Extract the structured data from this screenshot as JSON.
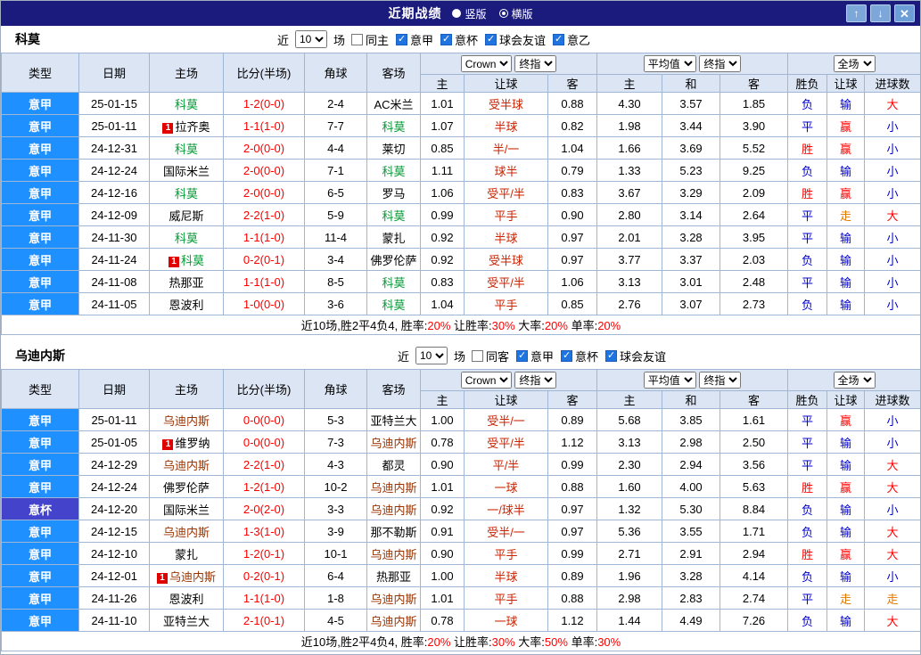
{
  "titlebar": {
    "title": "近期战绩",
    "layout_options": [
      {
        "label": "竖版",
        "selected": false
      },
      {
        "label": "横版",
        "selected": true
      }
    ],
    "up_button": "↑",
    "down_button": "↓",
    "close_button": "✕"
  },
  "labels": {
    "near": "近",
    "count": "10",
    "games": "场"
  },
  "headers": {
    "type": "类型",
    "date": "日期",
    "home": "主场",
    "score": "比分(半场)",
    "corner": "角球",
    "away": "客场",
    "sub": [
      "主",
      "让球",
      "客",
      "主",
      "和",
      "客",
      "胜负",
      "让球",
      "进球数"
    ],
    "selects": {
      "bookmaker": "Crown",
      "final_index_1": "终指",
      "average": "平均值",
      "final_index_2": "终指",
      "scope": "全场"
    }
  },
  "cup_label": "意杯",
  "card_badge": "1",
  "colors": {
    "accent_red": "#ff0000",
    "accent_blue": "#0000cc",
    "accent_orange": "#e07800",
    "handicap_red": "#cc2200",
    "league_bg": "#1e90ff",
    "cup_bg": "#4343cc",
    "titlebar_bg": "#1b1b7d"
  },
  "result_colors": {
    "胜": "accent_red",
    "赢": "accent_red",
    "大": "accent_red",
    "平": "accent_blue",
    "负": "accent_blue",
    "输": "accent_blue",
    "小": "accent_blue",
    "走": "accent_orange"
  },
  "tables": [
    {
      "team": "科莫",
      "team_color": "#009933",
      "filters": [
        {
          "label": "同主",
          "checked": false
        },
        {
          "label": "意甲",
          "checked": true
        },
        {
          "label": "意杯",
          "checked": true
        },
        {
          "label": "球会友谊",
          "checked": true
        },
        {
          "label": "意乙",
          "checked": true
        }
      ],
      "rows": [
        {
          "type": "意甲",
          "date": "25-01-15",
          "home": "科莫",
          "card": false,
          "score": "1-2(0-0)",
          "corner": "2-4",
          "away": "AC米兰",
          "odds": [
            "1.01",
            "受半球",
            "0.88"
          ],
          "avg": [
            "4.30",
            "3.57",
            "1.85"
          ],
          "res": [
            "负",
            "输",
            "大"
          ]
        },
        {
          "type": "意甲",
          "date": "25-01-11",
          "home": "拉齐奥",
          "card": true,
          "score": "1-1(1-0)",
          "corner": "7-7",
          "away": "科莫",
          "odds": [
            "1.07",
            "半球",
            "0.82"
          ],
          "avg": [
            "1.98",
            "3.44",
            "3.90"
          ],
          "res": [
            "平",
            "赢",
            "小"
          ]
        },
        {
          "type": "意甲",
          "date": "24-12-31",
          "home": "科莫",
          "card": false,
          "score": "2-0(0-0)",
          "corner": "4-4",
          "away": "莱切",
          "odds": [
            "0.85",
            "半/一",
            "1.04"
          ],
          "avg": [
            "1.66",
            "3.69",
            "5.52"
          ],
          "res": [
            "胜",
            "赢",
            "小"
          ]
        },
        {
          "type": "意甲",
          "date": "24-12-24",
          "home": "国际米兰",
          "card": false,
          "score": "2-0(0-0)",
          "corner": "7-1",
          "away": "科莫",
          "odds": [
            "1.11",
            "球半",
            "0.79"
          ],
          "avg": [
            "1.33",
            "5.23",
            "9.25"
          ],
          "res": [
            "负",
            "输",
            "小"
          ]
        },
        {
          "type": "意甲",
          "date": "24-12-16",
          "home": "科莫",
          "card": false,
          "score": "2-0(0-0)",
          "corner": "6-5",
          "away": "罗马",
          "odds": [
            "1.06",
            "受平/半",
            "0.83"
          ],
          "avg": [
            "3.67",
            "3.29",
            "2.09"
          ],
          "res": [
            "胜",
            "赢",
            "小"
          ]
        },
        {
          "type": "意甲",
          "date": "24-12-09",
          "home": "威尼斯",
          "card": false,
          "score": "2-2(1-0)",
          "corner": "5-9",
          "away": "科莫",
          "odds": [
            "0.99",
            "平手",
            "0.90"
          ],
          "avg": [
            "2.80",
            "3.14",
            "2.64"
          ],
          "res": [
            "平",
            "走",
            "大"
          ]
        },
        {
          "type": "意甲",
          "date": "24-11-30",
          "home": "科莫",
          "card": false,
          "score": "1-1(1-0)",
          "corner": "11-4",
          "away": "蒙扎",
          "odds": [
            "0.92",
            "半球",
            "0.97"
          ],
          "avg": [
            "2.01",
            "3.28",
            "3.95"
          ],
          "res": [
            "平",
            "输",
            "小"
          ]
        },
        {
          "type": "意甲",
          "date": "24-11-24",
          "home": "科莫",
          "card": true,
          "score": "0-2(0-1)",
          "corner": "3-4",
          "away": "佛罗伦萨",
          "odds": [
            "0.92",
            "受半球",
            "0.97"
          ],
          "avg": [
            "3.77",
            "3.37",
            "2.03"
          ],
          "res": [
            "负",
            "输",
            "小"
          ]
        },
        {
          "type": "意甲",
          "date": "24-11-08",
          "home": "热那亚",
          "card": false,
          "score": "1-1(1-0)",
          "corner": "8-5",
          "away": "科莫",
          "odds": [
            "0.83",
            "受平/半",
            "1.06"
          ],
          "avg": [
            "3.13",
            "3.01",
            "2.48"
          ],
          "res": [
            "平",
            "输",
            "小"
          ]
        },
        {
          "type": "意甲",
          "date": "24-11-05",
          "home": "恩波利",
          "card": false,
          "score": "1-0(0-0)",
          "corner": "3-6",
          "away": "科莫",
          "odds": [
            "1.04",
            "平手",
            "0.85"
          ],
          "avg": [
            "2.76",
            "3.07",
            "2.73"
          ],
          "res": [
            "负",
            "输",
            "小"
          ]
        }
      ],
      "summary": [
        {
          "text": "近10场,胜2平4负4, 胜率:",
          "red": false
        },
        {
          "text": "20%",
          "red": true
        },
        {
          "text": " 让胜率:",
          "red": false
        },
        {
          "text": "30%",
          "red": true
        },
        {
          "text": " 大率:",
          "red": false
        },
        {
          "text": "20%",
          "red": true
        },
        {
          "text": " 单率:",
          "red": false
        },
        {
          "text": "20%",
          "red": true
        }
      ]
    },
    {
      "team": "乌迪内斯",
      "team_color": "#993300",
      "filters": [
        {
          "label": "同客",
          "checked": false
        },
        {
          "label": "意甲",
          "checked": true
        },
        {
          "label": "意杯",
          "checked": true
        },
        {
          "label": "球会友谊",
          "checked": true
        }
      ],
      "rows": [
        {
          "type": "意甲",
          "date": "25-01-11",
          "home": "乌迪内斯",
          "card": false,
          "score": "0-0(0-0)",
          "corner": "5-3",
          "away": "亚特兰大",
          "odds": [
            "1.00",
            "受半/一",
            "0.89"
          ],
          "avg": [
            "5.68",
            "3.85",
            "1.61"
          ],
          "res": [
            "平",
            "赢",
            "小"
          ]
        },
        {
          "type": "意甲",
          "date": "25-01-05",
          "home": "维罗纳",
          "card": true,
          "score": "0-0(0-0)",
          "corner": "7-3",
          "away": "乌迪内斯",
          "odds": [
            "0.78",
            "受平/半",
            "1.12"
          ],
          "avg": [
            "3.13",
            "2.98",
            "2.50"
          ],
          "res": [
            "平",
            "输",
            "小"
          ]
        },
        {
          "type": "意甲",
          "date": "24-12-29",
          "home": "乌迪内斯",
          "card": false,
          "score": "2-2(1-0)",
          "corner": "4-3",
          "away": "都灵",
          "odds": [
            "0.90",
            "平/半",
            "0.99"
          ],
          "avg": [
            "2.30",
            "2.94",
            "3.56"
          ],
          "res": [
            "平",
            "输",
            "大"
          ]
        },
        {
          "type": "意甲",
          "date": "24-12-24",
          "home": "佛罗伦萨",
          "card": false,
          "score": "1-2(1-0)",
          "corner": "10-2",
          "away": "乌迪内斯",
          "odds": [
            "1.01",
            "一球",
            "0.88"
          ],
          "avg": [
            "1.60",
            "4.00",
            "5.63"
          ],
          "res": [
            "胜",
            "赢",
            "大"
          ]
        },
        {
          "type": "意杯",
          "date": "24-12-20",
          "home": "国际米兰",
          "card": false,
          "score": "2-0(2-0)",
          "corner": "3-3",
          "away": "乌迪内斯",
          "odds": [
            "0.92",
            "一/球半",
            "0.97"
          ],
          "avg": [
            "1.32",
            "5.30",
            "8.84"
          ],
          "res": [
            "负",
            "输",
            "小"
          ]
        },
        {
          "type": "意甲",
          "date": "24-12-15",
          "home": "乌迪内斯",
          "card": false,
          "score": "1-3(1-0)",
          "corner": "3-9",
          "away": "那不勒斯",
          "odds": [
            "0.91",
            "受半/一",
            "0.97"
          ],
          "avg": [
            "5.36",
            "3.55",
            "1.71"
          ],
          "res": [
            "负",
            "输",
            "大"
          ]
        },
        {
          "type": "意甲",
          "date": "24-12-10",
          "home": "蒙扎",
          "card": false,
          "score": "1-2(0-1)",
          "corner": "10-1",
          "away": "乌迪内斯",
          "odds": [
            "0.90",
            "平手",
            "0.99"
          ],
          "avg": [
            "2.71",
            "2.91",
            "2.94"
          ],
          "res": [
            "胜",
            "赢",
            "大"
          ]
        },
        {
          "type": "意甲",
          "date": "24-12-01",
          "home": "乌迪内斯",
          "card": true,
          "score": "0-2(0-1)",
          "corner": "6-4",
          "away": "热那亚",
          "odds": [
            "1.00",
            "半球",
            "0.89"
          ],
          "avg": [
            "1.96",
            "3.28",
            "4.14"
          ],
          "res": [
            "负",
            "输",
            "小"
          ]
        },
        {
          "type": "意甲",
          "date": "24-11-26",
          "home": "恩波利",
          "card": false,
          "score": "1-1(1-0)",
          "corner": "1-8",
          "away": "乌迪内斯",
          "odds": [
            "1.01",
            "平手",
            "0.88"
          ],
          "avg": [
            "2.98",
            "2.83",
            "2.74"
          ],
          "res": [
            "平",
            "走",
            "走"
          ]
        },
        {
          "type": "意甲",
          "date": "24-11-10",
          "home": "亚特兰大",
          "card": false,
          "score": "2-1(0-1)",
          "corner": "4-5",
          "away": "乌迪内斯",
          "odds": [
            "0.78",
            "一球",
            "1.12"
          ],
          "avg": [
            "1.44",
            "4.49",
            "7.26"
          ],
          "res": [
            "负",
            "输",
            "大"
          ]
        }
      ],
      "summary": [
        {
          "text": "近10场,胜2平4负4, 胜率:",
          "red": false
        },
        {
          "text": "20%",
          "red": true
        },
        {
          "text": " 让胜率:",
          "red": false
        },
        {
          "text": "30%",
          "red": true
        },
        {
          "text": " 大率:",
          "red": false
        },
        {
          "text": "50%",
          "red": true
        },
        {
          "text": " 单率:",
          "red": false
        },
        {
          "text": "30%",
          "red": true
        }
      ]
    }
  ]
}
